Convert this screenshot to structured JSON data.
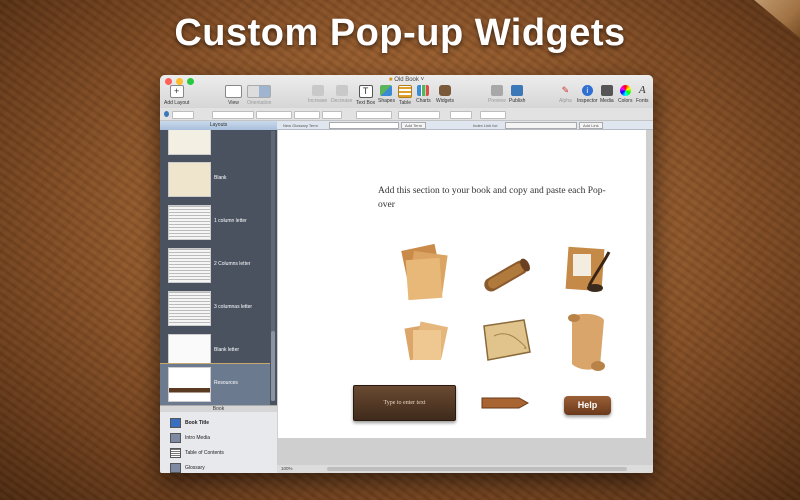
{
  "headline": "Custom Pop-up Widgets",
  "window": {
    "title": "Old Book",
    "toolbar": {
      "add_layout": "Add Layout",
      "view": "View",
      "orientation": "Orientation",
      "increase": "Increase",
      "decrease": "Decrease",
      "text_box": "Text Box",
      "shapes": "Shapes",
      "table": "Table",
      "charts": "Charts",
      "widgets": "Widgets",
      "preview": "Preview",
      "publish": "Publish",
      "alpha": "Alpha",
      "inspector": "Inspector",
      "media": "Media",
      "colors": "Colors",
      "fonts": "Fonts"
    },
    "glossary": {
      "new_term": "New Glossary Term",
      "add_term": "Add Term",
      "index_link_for": "Index Link for:",
      "add_link": "Add Link"
    },
    "sidebar": {
      "layouts_header": "Layouts",
      "layouts": [
        {
          "label": ""
        },
        {
          "label": "Blank"
        },
        {
          "label": "1 column letter"
        },
        {
          "label": "2 Columns letter"
        },
        {
          "label": "3 columnas letter"
        },
        {
          "label": "Blank letter"
        },
        {
          "label": "Resources"
        }
      ],
      "book_header": "Book",
      "book_items": [
        {
          "label": "Book Title"
        },
        {
          "label": "Intro Media"
        },
        {
          "label": "Table of Contents"
        },
        {
          "label": "Glossary"
        }
      ]
    },
    "page": {
      "instruction": "Add this section to your book and copy and paste each Pop-over",
      "textbox_placeholder": "Type to enter text",
      "help_label": "Help"
    },
    "status": {
      "zoom": "100%"
    }
  },
  "colors": {
    "close": "#ff5f57",
    "minimize": "#febc2e",
    "zoom": "#28c840",
    "sidebar": "#4a5260"
  }
}
